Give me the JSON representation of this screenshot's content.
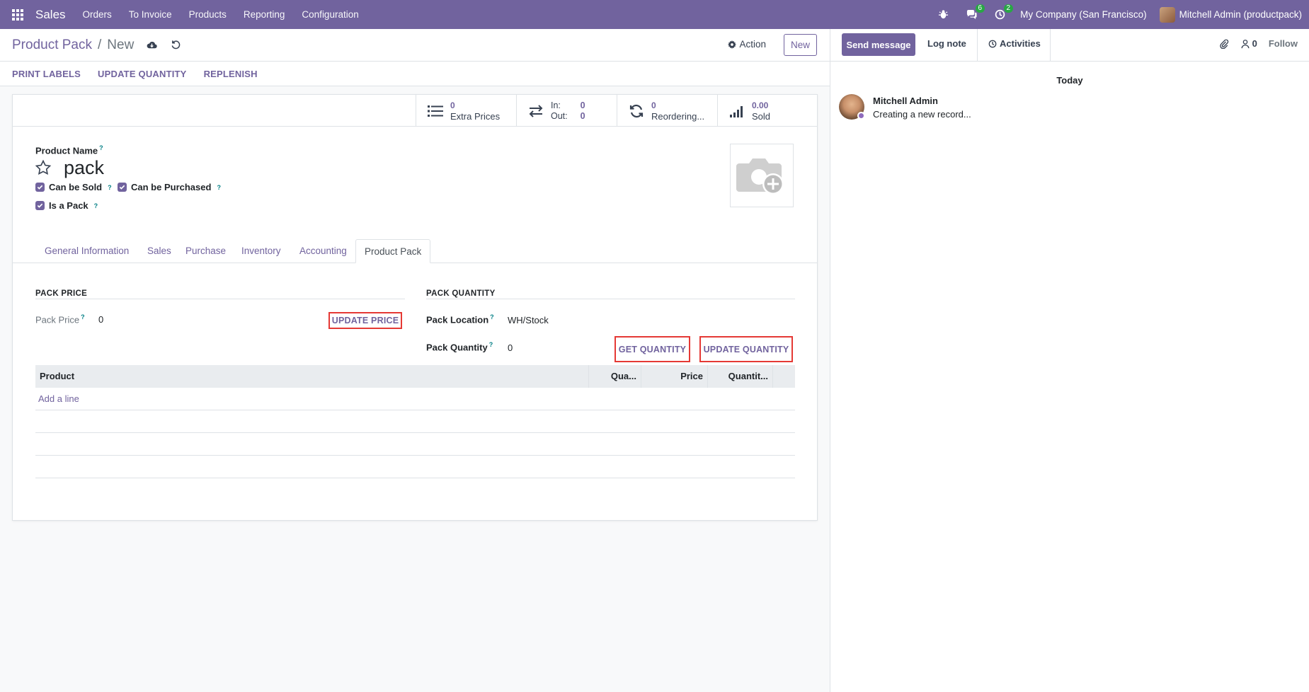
{
  "navbar": {
    "brand": "Sales",
    "menus": [
      "Orders",
      "To Invoice",
      "Products",
      "Reporting",
      "Configuration"
    ],
    "messages_badge": "6",
    "activities_badge": "2",
    "company": "My Company (San Francisco)",
    "user": "Mitchell Admin (productpack)"
  },
  "control": {
    "breadcrumb_parent": "Product Pack",
    "breadcrumb_sep": "/",
    "breadcrumb_current": "New",
    "action_label": "Action",
    "new_label": "New"
  },
  "statusbar": {
    "buttons": [
      "PRINT LABELS",
      "UPDATE QUANTITY",
      "REPLENISH"
    ]
  },
  "stats": {
    "extra_prices": {
      "value": "0",
      "label": "Extra Prices"
    },
    "inout": {
      "in_label": "In:",
      "in_value": "0",
      "out_label": "Out:",
      "out_value": "0"
    },
    "reordering": {
      "value": "0",
      "label": "Reordering..."
    },
    "sold": {
      "value": "0.00",
      "label": "Sold"
    }
  },
  "form": {
    "product_name_label": "Product Name",
    "product_name": "pack",
    "help": "?",
    "checkboxes": {
      "can_be_sold": "Can be Sold",
      "can_be_purchased": "Can be Purchased",
      "is_pack": "Is a Pack"
    },
    "tabs": [
      "General Information",
      "Sales",
      "Purchase",
      "Inventory",
      "Accounting",
      "Product Pack"
    ],
    "active_tab": "Product Pack",
    "pack_price": {
      "section_title": "PACK PRICE",
      "label": "Pack Price",
      "value": "0",
      "button": "UPDATE PRICE"
    },
    "pack_quantity": {
      "section_title": "PACK QUANTITY",
      "location_label": "Pack Location",
      "location_value": "WH/Stock",
      "quantity_label": "Pack Quantity",
      "quantity_value": "0",
      "get_button": "GET QUANTITY",
      "update_button": "UPDATE QUANTITY"
    },
    "lines": {
      "columns": [
        "Product",
        "Qua...",
        "Price",
        "Quantit..."
      ],
      "add_line": "Add a line"
    }
  },
  "chatter": {
    "send_message": "Send message",
    "log_note": "Log note",
    "activities": "Activities",
    "followers_count": "0",
    "follow": "Follow",
    "date_separator": "Today",
    "message": {
      "author": "Mitchell Admin",
      "body": "Creating a new record..."
    }
  },
  "colors": {
    "brand": "#71639e",
    "badge": "#28a745",
    "highlight": "#e53935"
  }
}
